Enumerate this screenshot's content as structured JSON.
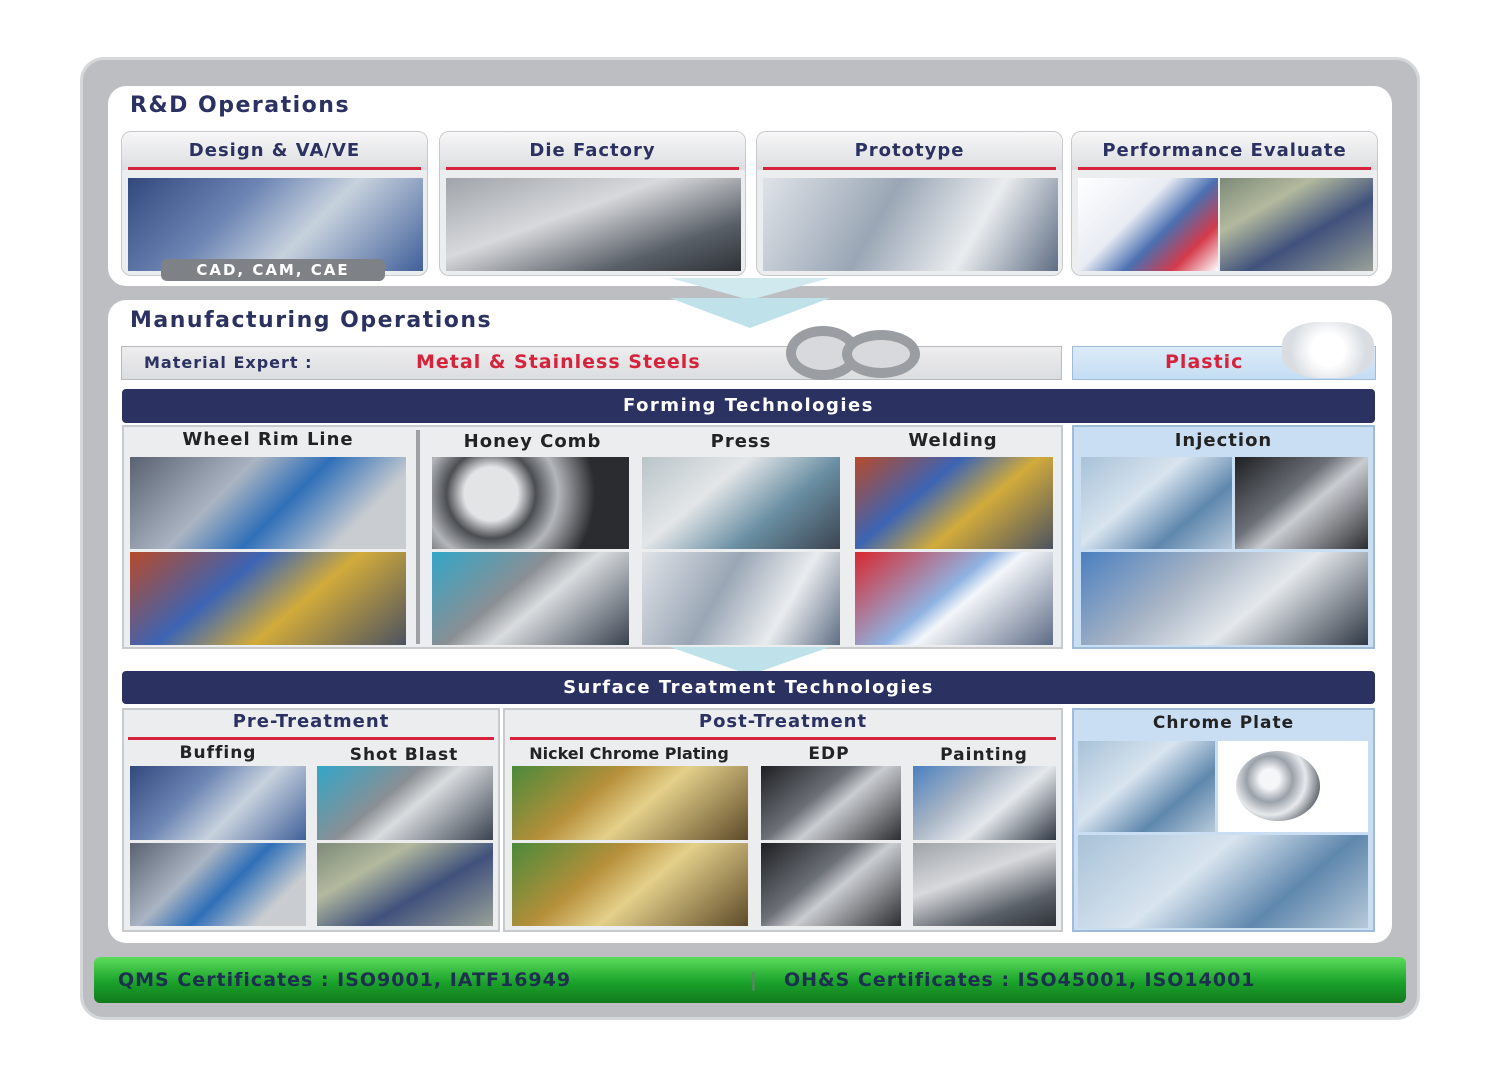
{
  "rd": {
    "title": "R&D Operations",
    "cards": [
      {
        "label": "Design & VA/VE"
      },
      {
        "label": "Die Factory"
      },
      {
        "label": "Prototype"
      },
      {
        "label": "Performance Evaluate"
      }
    ],
    "cad_tag": "CAD, CAM, CAE"
  },
  "mfg": {
    "title": "Manufacturing Operations",
    "material_label": "Material Expert :",
    "material_metal": "Metal & Stainless Steels",
    "material_plastic": "Plastic",
    "forming_title": "Forming Technologies",
    "forming": [
      {
        "label": "Wheel Rim Line"
      },
      {
        "label": "Honey Comb"
      },
      {
        "label": "Press"
      },
      {
        "label": "Welding"
      },
      {
        "label": "Injection"
      }
    ],
    "surface_title": "Surface Treatment Technologies",
    "pre_treatment": "Pre-Treatment",
    "post_treatment": "Post-Treatment",
    "surface": [
      {
        "label": "Buffing"
      },
      {
        "label": "Shot Blast"
      },
      {
        "label": "Nickel Chrome Plating"
      },
      {
        "label": "EDP"
      },
      {
        "label": "Painting"
      },
      {
        "label": "Chrome Plate"
      }
    ]
  },
  "footer": {
    "qms": "QMS Certificates : ISO9001, IATF16949",
    "divider": "|",
    "ohs": "OH&S Certificates : ISO45001, ISO14001"
  },
  "colors": {
    "navy": "#2b3160",
    "accent_red": "#d6223a",
    "footer_green": "#1aa22a",
    "plastic_blue": "#c9def3"
  }
}
